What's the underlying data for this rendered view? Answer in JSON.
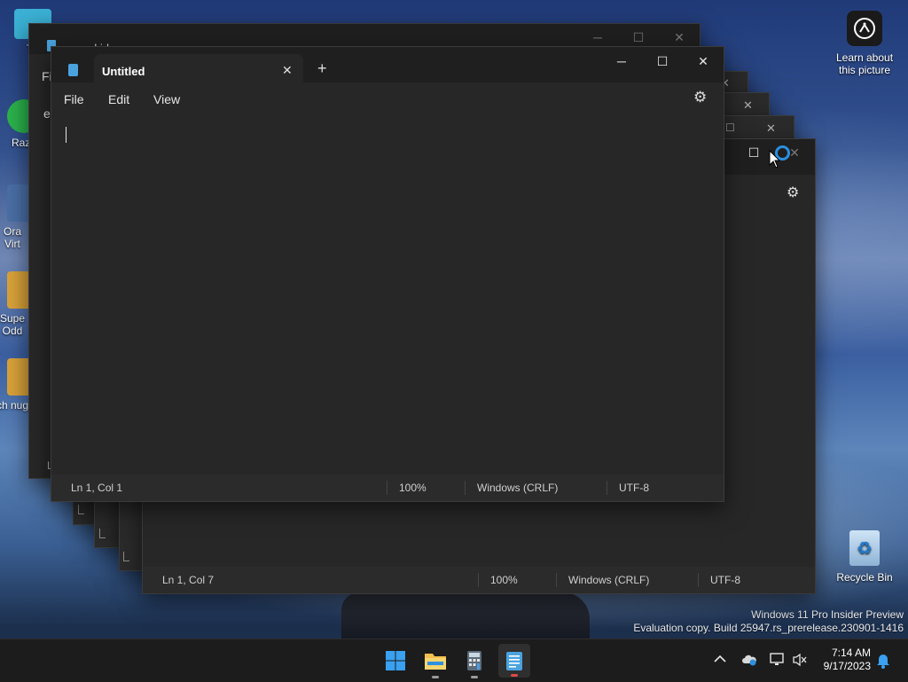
{
  "desktop": {
    "icons": [
      {
        "label": "Th",
        "color": "#3bb2d6"
      },
      {
        "label": "Raze",
        "color": "#2bb24c"
      },
      {
        "label": "Ora Virt",
        "color": "#4a6fa5"
      },
      {
        "label": "Supe Odd",
        "color": "#d8a23a"
      },
      {
        "label": "ch nug",
        "color": "#d8a23a"
      }
    ],
    "learn_label": "Learn about this picture",
    "recycle_bin_label": "Recycle Bin",
    "watermark": {
      "line1": "Windows 11 Pro Insider Preview",
      "line2": "Evaluation copy. Build 25947.rs_prerelease.230901-1416"
    }
  },
  "background_windows": {
    "top_tab_title": "es kid",
    "top_menu_fragment": "Fil",
    "side_fragment": "e",
    "status_fragment": "L",
    "back_status": {
      "position": "Ln 1, Col 7",
      "zoom": "100%",
      "line_ending": "Windows (CRLF)",
      "encoding": "UTF-8"
    }
  },
  "notepad": {
    "tab_title": "Untitled",
    "menu": [
      "File",
      "Edit",
      "View"
    ],
    "status": {
      "position": "Ln 1, Col 1",
      "zoom": "100%",
      "line_ending": "Windows (CRLF)",
      "encoding": "UTF-8"
    }
  },
  "taskbar": {
    "apps": [
      "start-icon",
      "file-explorer-icon",
      "calculator-icon",
      "notepad-icon"
    ],
    "tray": {
      "time": "7:14 AM",
      "date": "9/17/2023"
    }
  },
  "colors": {
    "accent": "#0078d4",
    "window_bg": "#272727",
    "titlebar_bg": "#1f1f1f"
  }
}
